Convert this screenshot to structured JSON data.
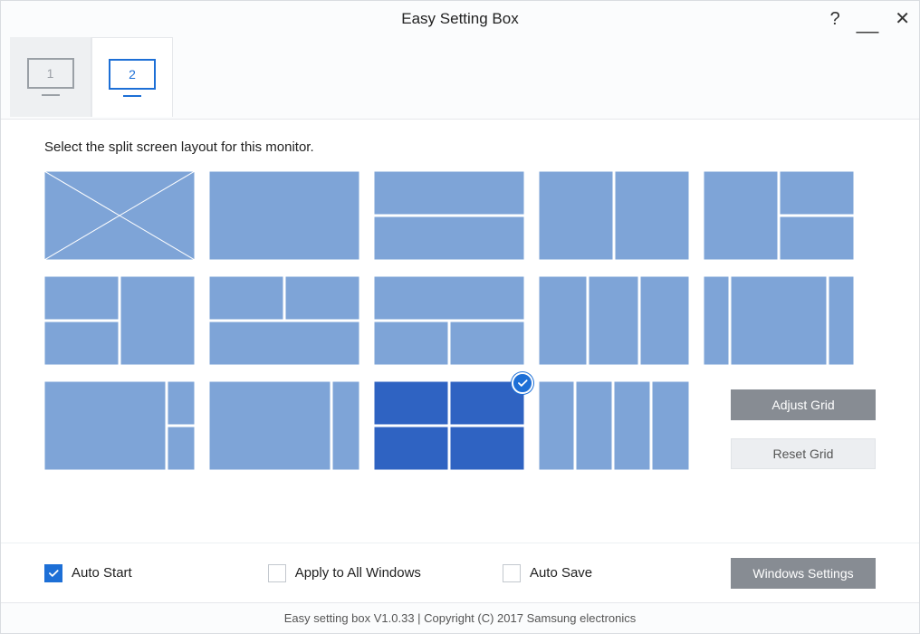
{
  "window": {
    "title": "Easy Setting Box"
  },
  "tabs": {
    "monitor1": "1",
    "monitor2": "2",
    "active": "2"
  },
  "instruction": "Select the split screen layout for this monitor.",
  "layouts": {
    "selected_index": 12
  },
  "buttons": {
    "adjust": "Adjust Grid",
    "reset": "Reset Grid",
    "windows_settings": "Windows Settings"
  },
  "options": {
    "auto_start": {
      "label": "Auto Start",
      "checked": true
    },
    "apply_all": {
      "label": "Apply to All Windows",
      "checked": false
    },
    "auto_save": {
      "label": "Auto Save",
      "checked": false
    }
  },
  "statusbar": "Easy setting box V1.0.33 | Copyright (C) 2017 Samsung electronics"
}
